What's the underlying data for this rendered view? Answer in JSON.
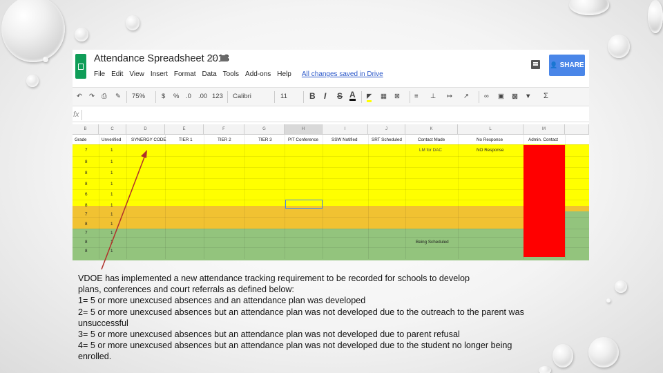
{
  "app": {
    "title": "Attendance Spreadsheet 2013",
    "menu": [
      "File",
      "Edit",
      "View",
      "Insert",
      "Format",
      "Data",
      "Tools",
      "Add-ons",
      "Help"
    ],
    "save_status": "All changes saved in Drive",
    "share_label": "SHARE"
  },
  "toolbar": {
    "zoom": "75%",
    "currency": "$",
    "percent": "%",
    "decimal_less": ".0",
    "decimal_more": ".00",
    "number_format": "123",
    "font": "Calibri",
    "font_size": "11",
    "bold": "B",
    "italic": "I",
    "strike": "S",
    "text_color": "A",
    "sum": "Σ"
  },
  "formula_bar": {
    "fx": "fx",
    "value": ""
  },
  "columns": [
    "B",
    "C",
    "D",
    "E",
    "F",
    "G",
    "H",
    "I",
    "J",
    "K",
    "L",
    "M"
  ],
  "header_row": [
    "Grade",
    "Unverified",
    "SYNERGY CODE",
    "TIER 1",
    "TIER 2",
    "TIER 3",
    "P/T Conference",
    "SSW Notified",
    "SRT Scheduled",
    "Contact Made",
    "No Response",
    "Admin. Contact"
  ],
  "rows": [
    {
      "grade": "7",
      "unverified": "1",
      "contact": "LM for DAC",
      "no_response": "NO Response",
      "note": ""
    },
    {
      "grade": "8",
      "unverified": "1",
      "contact": "",
      "no_response": "",
      "note": ""
    },
    {
      "grade": "8",
      "unverified": "1",
      "contact": "",
      "no_response": "",
      "note": ""
    },
    {
      "grade": "8",
      "unverified": "1",
      "contact": "",
      "no_response": "",
      "note": ""
    },
    {
      "grade": "6",
      "unverified": "1",
      "contact": "",
      "no_response": "",
      "note": ""
    },
    {
      "grade": "8",
      "unverified": "1",
      "contact": "",
      "no_response": "",
      "note": ""
    },
    {
      "grade": "7",
      "unverified": "1",
      "contact": "",
      "no_response": "",
      "note": ""
    },
    {
      "grade": "8",
      "unverified": "1",
      "contact": "",
      "no_response": "",
      "note": ""
    },
    {
      "grade": "7",
      "unverified": "1",
      "contact": "",
      "no_response": "",
      "note": ""
    },
    {
      "grade": "8",
      "unverified": "1",
      "contact": "",
      "no_response": "",
      "note": "Being Scheduled"
    },
    {
      "grade": "8",
      "unverified": "1",
      "contact": "",
      "no_response": "",
      "note": ""
    }
  ],
  "colors": {
    "yellow": "#ffff00",
    "orange": "#f1c232",
    "green": "#93c47d",
    "red": "#ff0000",
    "sheets_green": "#0f9d58",
    "share_blue": "#4a86e8",
    "arrow": "#b0302a"
  },
  "description": [
    "VDOE has implemented a new attendance tracking requirement to be recorded for schools to develop",
    "plans, conferences and court referrals as defined below:",
    "1= 5 or more unexcused absences and an attendance plan was developed",
    "2= 5 or more unexcused absences but an attendance plan was not developed due to the outreach to the parent was",
    "unsuccessful",
    "3= 5 or more unexcused absences but an attendance plan was not developed due to parent refusal",
    "4= 5 or more unexcused absences but an attendance plan was not developed due to the student no longer being",
    "enrolled."
  ]
}
